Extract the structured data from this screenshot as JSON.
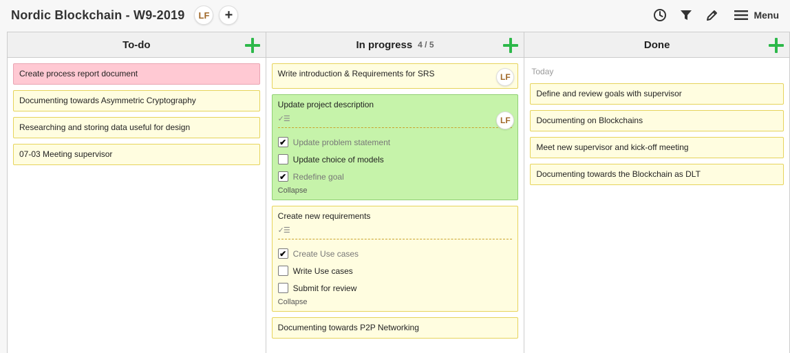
{
  "board": {
    "title": "Nordic Blockchain - W9-2019",
    "member_initials": "LF",
    "add_member": "+"
  },
  "toolbar": {
    "icons": [
      "history-icon",
      "filter-icon",
      "pencil-icon",
      "hamburger-icon"
    ],
    "menu_label": "Menu"
  },
  "lists": {
    "todo": {
      "title": "To-do",
      "cards": [
        "Create process report document",
        "Documenting towards Asymmetric Cryptography",
        "Researching and storing data useful for design",
        "07-03 Meeting supervisor"
      ]
    },
    "in_progress": {
      "title": "In progress",
      "count": "4 / 5",
      "cards": {
        "c0": {
          "title": "Write introduction & Requirements for SRS",
          "member": "LF"
        },
        "c1": {
          "title": "Update project description",
          "member": "LF",
          "checklist_icon": "checklist-icon",
          "items": [
            {
              "label": "Update problem statement",
              "checked": "✔"
            },
            {
              "label": "Update choice of models",
              "checked": ""
            },
            {
              "label": "Redefine goal",
              "checked": "✔"
            }
          ],
          "collapse": "Collapse"
        },
        "c2": {
          "title": "Create new requirements",
          "checklist_icon": "checklist-icon",
          "items": [
            {
              "label": "Create Use cases",
              "checked": "✔"
            },
            {
              "label": "Write Use cases",
              "checked": ""
            },
            {
              "label": "Submit for review",
              "checked": ""
            }
          ],
          "collapse": "Collapse"
        },
        "c3": {
          "title": "Documenting towards P2P Networking"
        }
      }
    },
    "done": {
      "title": "Done",
      "section": "Today",
      "cards": [
        "Define and review goals with supervisor",
        "Documenting on Blockchains",
        "Meet new supervisor and kick-off meeting",
        "Documenting towards the Blockchain as DLT"
      ]
    }
  },
  "colors": {
    "yellow_card": "#fffde0",
    "pink_card": "#ffc9d3",
    "green_card": "#c6f3aa",
    "add_green": "#2db84a"
  }
}
